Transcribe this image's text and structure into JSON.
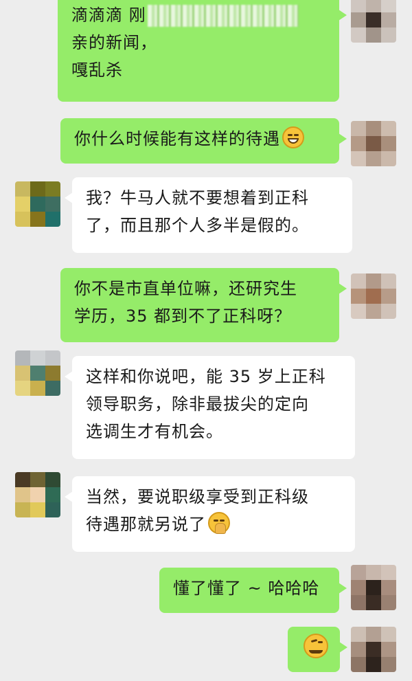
{
  "messages": [
    {
      "side": "right",
      "lines": [
        "滴滴滴 刚",
        "亲的新闻，",
        "嘎乱杀"
      ]
    },
    {
      "side": "right",
      "lines": [
        "你什么时候能有这样的待遇"
      ],
      "emoji": "grin-emoji"
    },
    {
      "side": "left",
      "lines": [
        "我？牛马人就不要想着到正科",
        "了，而且那个人多半是假的。"
      ]
    },
    {
      "side": "right",
      "lines": [
        "你不是市直单位嘛，还研究生",
        "学历，35 都到不了正科呀？"
      ]
    },
    {
      "side": "left",
      "lines": [
        "这样和你说吧，能 35 岁上正科",
        "领导职务，除非最拔尖的定向",
        "选调生才有机会。"
      ]
    },
    {
      "side": "left",
      "lines": [
        "当然，要说职级享受到正科级",
        "待遇那就另说了"
      ],
      "emoji": "shush-emoji"
    },
    {
      "side": "right",
      "lines": [
        "懂了懂了 ~ 哈哈哈"
      ]
    },
    {
      "side": "right",
      "lines": [],
      "emoji": "smirk-emoji"
    }
  ],
  "colors": {
    "background": "#ededed",
    "sent_bubble": "#95ec69",
    "received_bubble": "#ffffff"
  }
}
